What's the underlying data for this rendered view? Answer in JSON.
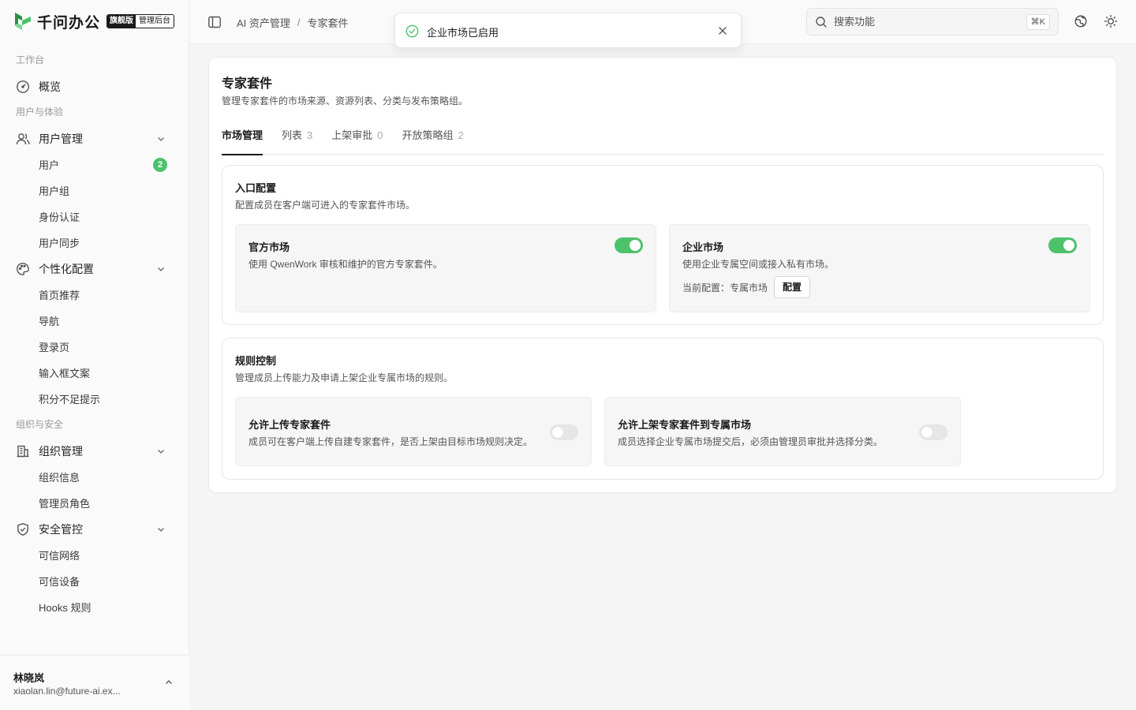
{
  "brand": {
    "name": "千问办公",
    "badge_edition": "旗舰版",
    "badge_console": "管理后台",
    "color": "#4cc26b"
  },
  "sidebar": {
    "sections": [
      {
        "label": "工作台"
      },
      {
        "label": "用户与体验"
      },
      {
        "label": "组织与安全"
      }
    ],
    "overview": {
      "label": "概览",
      "icon": "dashboard-icon"
    },
    "user_mgmt": {
      "label": "用户管理",
      "icon": "user-icon",
      "items": [
        {
          "label": "用户",
          "badge": "2"
        },
        {
          "label": "用户组"
        },
        {
          "label": "身份认证"
        },
        {
          "label": "用户同步"
        }
      ]
    },
    "personalize": {
      "label": "个性化配置",
      "icon": "palette-icon",
      "items": [
        {
          "label": "首页推荐"
        },
        {
          "label": "导航"
        },
        {
          "label": "登录页"
        },
        {
          "label": "输入框文案"
        },
        {
          "label": "积分不足提示"
        }
      ]
    },
    "org_mgmt": {
      "label": "组织管理",
      "icon": "building-icon",
      "items": [
        {
          "label": "组织信息"
        },
        {
          "label": "管理员角色"
        }
      ]
    },
    "security": {
      "label": "安全管控",
      "icon": "shield-icon",
      "items": [
        {
          "label": "可信网络"
        },
        {
          "label": "可信设备"
        },
        {
          "label": "Hooks 规则"
        }
      ]
    },
    "user": {
      "name": "林晓岚",
      "email": "xiaolan.lin@future-ai.ex..."
    }
  },
  "header": {
    "breadcrumb": [
      "AI 资产管理",
      "专家套件"
    ],
    "breadcrumb_sep": "/",
    "search_placeholder": "搜索功能",
    "shortcut": "⌘K"
  },
  "toast": {
    "message": "企业市场已启用"
  },
  "page": {
    "title": "专家套件",
    "description": "管理专家套件的市场来源、资源列表、分类与发布策略组。",
    "tabs": [
      {
        "label": "市场管理",
        "count": "",
        "active": true
      },
      {
        "label": "列表",
        "count": "3"
      },
      {
        "label": "上架审批",
        "count": "0"
      },
      {
        "label": "开放策略组",
        "count": "2"
      }
    ],
    "entry": {
      "title": "入口配置",
      "description": "配置成员在客户端可进入的专家套件市场。",
      "official": {
        "title": "官方市场",
        "description": "使用 QwenWork 审核和维护的官方专家套件。",
        "enabled": true
      },
      "enterprise": {
        "title": "企业市场",
        "description": "使用企业专属空间或接入私有市场。",
        "enabled": true,
        "current_label": "当前配置：",
        "current_value": "专属市场",
        "config_button": "配置"
      }
    },
    "rules": {
      "title": "规则控制",
      "description": "管理成员上传能力及申请上架企业专属市场的规则。",
      "allow_upload": {
        "title": "允许上传专家套件",
        "description": "成员可在客户端上传自建专家套件，是否上架由目标市场规则决定。",
        "enabled": false
      },
      "allow_publish": {
        "title": "允许上架专家套件到专属市场",
        "description": "成员选择企业专属市场提交后，必须由管理员审批并选择分类。",
        "enabled": false
      }
    }
  }
}
